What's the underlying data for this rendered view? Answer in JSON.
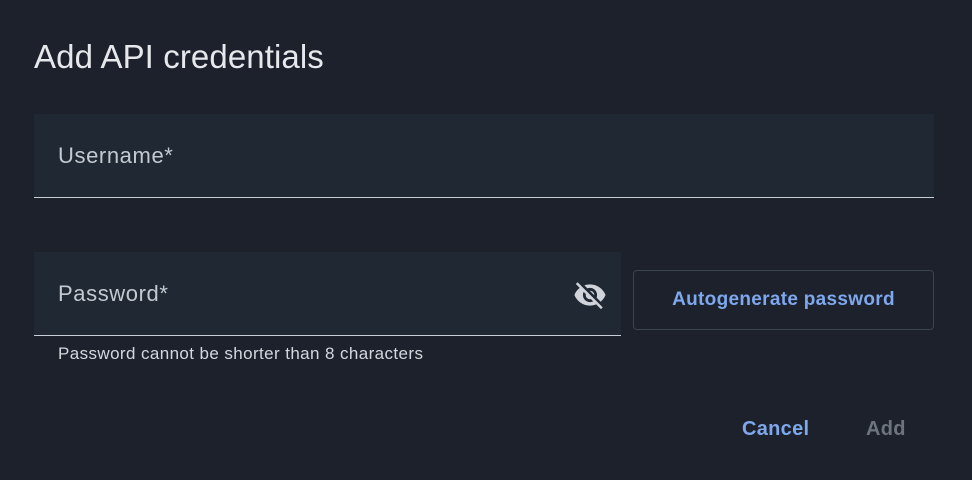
{
  "dialog": {
    "title": "Add API credentials"
  },
  "username_field": {
    "label": "Username*",
    "value": ""
  },
  "password_field": {
    "label": "Password*",
    "value": "",
    "toggle_icon": "eye-off-icon",
    "hint": "Password cannot be shorter than 8 characters"
  },
  "buttons": {
    "autogenerate_label": "Autogenerate password",
    "cancel_label": "Cancel",
    "add_label": "Add"
  },
  "colors": {
    "background": "#1c212b",
    "field_background": "#1f2833",
    "accent": "#7ea7ec",
    "disabled": "#6d747f"
  }
}
